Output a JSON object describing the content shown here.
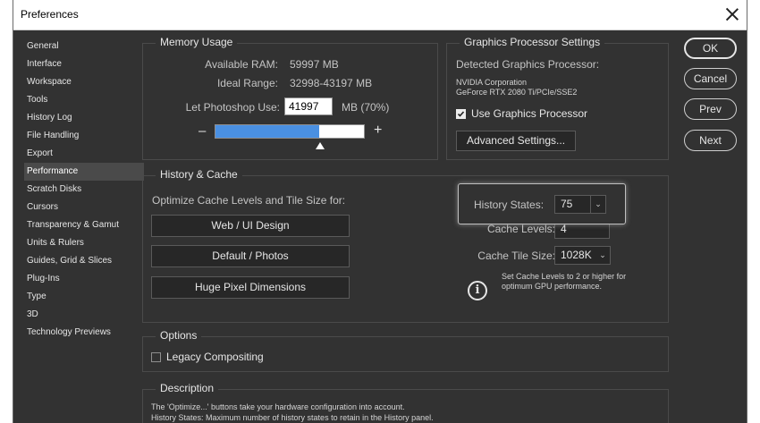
{
  "window": {
    "title": "Preferences"
  },
  "sidebar": {
    "items": [
      {
        "label": "General"
      },
      {
        "label": "Interface"
      },
      {
        "label": "Workspace"
      },
      {
        "label": "Tools"
      },
      {
        "label": "History Log"
      },
      {
        "label": "File Handling"
      },
      {
        "label": "Export"
      },
      {
        "label": "Performance"
      },
      {
        "label": "Scratch Disks"
      },
      {
        "label": "Cursors"
      },
      {
        "label": "Transparency & Gamut"
      },
      {
        "label": "Units & Rulers"
      },
      {
        "label": "Guides, Grid & Slices"
      },
      {
        "label": "Plug-Ins"
      },
      {
        "label": "Type"
      },
      {
        "label": "3D"
      },
      {
        "label": "Technology Previews"
      }
    ],
    "active": "Performance"
  },
  "memory": {
    "title": "Memory Usage",
    "available_label": "Available RAM:",
    "available_value": "59997 MB",
    "ideal_label": "Ideal Range:",
    "ideal_value": "32998-43197 MB",
    "let_label": "Let Photoshop Use:",
    "let_value": "41997",
    "let_unit": "MB (70%)",
    "minus": "–",
    "plus": "+",
    "slider_fraction": 0.7
  },
  "gpu": {
    "title": "Graphics Processor Settings",
    "detected_label": "Detected Graphics Processor:",
    "vendor": "NVIDIA Corporation",
    "model": "GeForce RTX 2080 Ti/PCIe/SSE2",
    "use_label": "Use Graphics Processor",
    "use_checked": true,
    "advanced_button": "Advanced Settings..."
  },
  "history_cache": {
    "title": "History & Cache",
    "optimize_label": "Optimize Cache Levels and Tile Size for:",
    "buttons": [
      "Web / UI Design",
      "Default / Photos",
      "Huge Pixel Dimensions"
    ],
    "history_states_label": "History States:",
    "history_states_value": "75",
    "cache_levels_label": "Cache Levels:",
    "cache_levels_value": "4",
    "cache_tile_label": "Cache Tile Size:",
    "cache_tile_value": "1028K",
    "info_line1": "Set Cache Levels to 2 or higher for",
    "info_line2": "optimum GPU performance."
  },
  "options": {
    "title": "Options",
    "legacy_label": "Legacy Compositing",
    "legacy_checked": false
  },
  "description": {
    "title": "Description",
    "line1": "The 'Optimize...' buttons take your hardware configuration into account.",
    "line2": "History States: Maximum number of history states to retain in the History panel."
  },
  "actions": {
    "ok": "OK",
    "cancel": "Cancel",
    "prev": "Prev",
    "next": "Next"
  }
}
